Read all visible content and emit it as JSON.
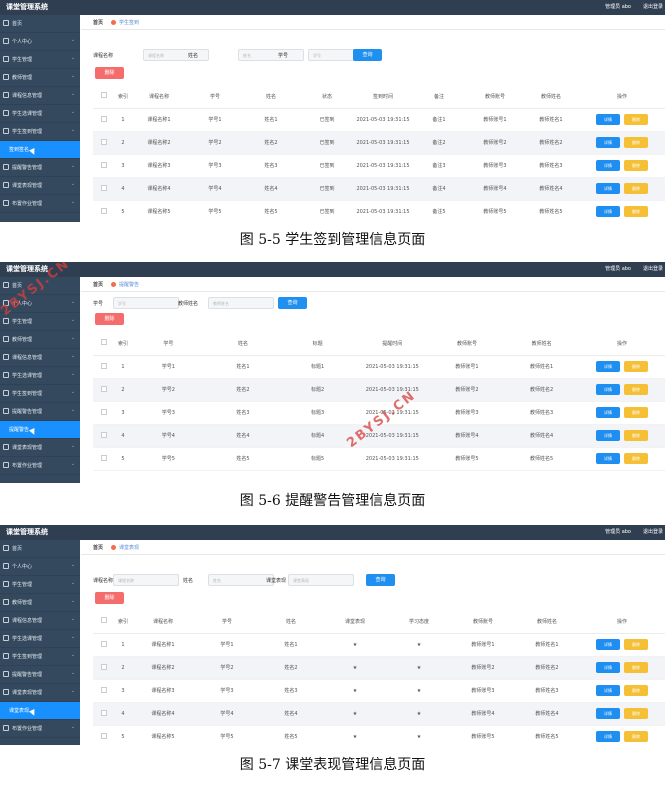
{
  "app_title": "课堂管理系统",
  "header": {
    "admin_label": "管理员 abo",
    "exit_label": "退出登录"
  },
  "sidebar": {
    "home": "首页",
    "items": [
      "个人中心",
      "学生管理",
      "教师管理",
      "课程信息管理",
      "学生选课管理",
      "学生签到管理",
      "提醒警告管理",
      "课堂表现管理",
      "布置作业管理"
    ]
  },
  "common": {
    "home_tab": "首页",
    "search_btn": "查询",
    "delete_btn": "删除",
    "detail_btn": "详情",
    "row_delete_btn": "删除",
    "ops_header": "操作",
    "index_header": "索引",
    "placeholder_course": "课程名称",
    "placeholder_account": "账号",
    "placeholder_teacher": "教师姓名"
  },
  "watermark": "2BYSJ.CN",
  "screens": [
    {
      "caption": "图 5-5 学生签到管理信息页面",
      "tab": "学生签到",
      "active_sidebar": 6,
      "sub_label": "签到签名",
      "filters": [
        {
          "label": "课程名称",
          "placeholder": "课程名称"
        },
        {
          "label": "姓名",
          "placeholder": "姓名"
        },
        {
          "label": "学号",
          "placeholder": "学号"
        }
      ],
      "columns": [
        "课程名称",
        "学号",
        "姓名",
        "状态",
        "签到时间",
        "备注",
        "教师账号",
        "教师姓名"
      ],
      "rows": [
        [
          "1",
          "课程名称1",
          "学号1",
          "姓名1",
          "已签到",
          "2021-05-03 19:31:15",
          "备注1",
          "教师账号1",
          "教师姓名1"
        ],
        [
          "2",
          "课程名称2",
          "学号2",
          "姓名2",
          "已签到",
          "2021-05-03 19:31:15",
          "备注2",
          "教师账号2",
          "教师姓名2"
        ],
        [
          "3",
          "课程名称3",
          "学号3",
          "姓名3",
          "已签到",
          "2021-05-03 19:31:15",
          "备注3",
          "教师账号3",
          "教师姓名3"
        ],
        [
          "4",
          "课程名称4",
          "学号4",
          "姓名4",
          "已签到",
          "2021-05-03 19:31:15",
          "备注4",
          "教师账号4",
          "教师姓名4"
        ],
        [
          "5",
          "课程名称5",
          "学号5",
          "姓名5",
          "已签到",
          "2021-05-03 19:31:15",
          "备注5",
          "教师账号5",
          "教师姓名5"
        ]
      ]
    },
    {
      "caption": "图 5-6 提醒警告管理信息页面",
      "tab": "提醒警告",
      "active_sidebar": 7,
      "sub_label": "提醒警告",
      "filters": [
        {
          "label": "学号",
          "placeholder": "学号"
        },
        {
          "label": "教师姓名",
          "placeholder": "教师姓名"
        }
      ],
      "columns": [
        "学号",
        "姓名",
        "标题",
        "提醒时间",
        "教师账号",
        "教师姓名"
      ],
      "rows": [
        [
          "1",
          "学号1",
          "姓名1",
          "标题1",
          "2021-05-03 19:31:15",
          "教师账号1",
          "教师姓名1"
        ],
        [
          "2",
          "学号2",
          "姓名2",
          "标题2",
          "2021-05-03 19:31:15",
          "教师账号2",
          "教师姓名2"
        ],
        [
          "3",
          "学号3",
          "姓名3",
          "标题3",
          "2021-05-03 19:31:15",
          "教师账号3",
          "教师姓名3"
        ],
        [
          "4",
          "学号4",
          "姓名4",
          "标题4",
          "2021-05-03 19:31:15",
          "教师账号4",
          "教师姓名4"
        ],
        [
          "5",
          "学号5",
          "姓名5",
          "标题5",
          "2021-05-03 19:31:15",
          "教师账号5",
          "教师姓名5"
        ]
      ]
    },
    {
      "caption": "图 5-7 课堂表现管理信息页面",
      "tab": "课堂表现",
      "active_sidebar": 8,
      "sub_label": "课堂表现",
      "filters": [
        {
          "label": "课程名称",
          "placeholder": "课程名称"
        },
        {
          "label": "姓名",
          "placeholder": "姓名"
        },
        {
          "label": "课堂表现",
          "placeholder": "课堂表现"
        }
      ],
      "columns": [
        "课程名称",
        "学号",
        "姓名",
        "课堂表现",
        "学习态度",
        "教师账号",
        "教师姓名"
      ],
      "rows": [
        [
          "1",
          "课程名称1",
          "学号1",
          "姓名1",
          "★",
          "★",
          "教师账号1",
          "教师姓名1"
        ],
        [
          "2",
          "课程名称2",
          "学号2",
          "姓名2",
          "★",
          "★",
          "教师账号2",
          "教师姓名2"
        ],
        [
          "3",
          "课程名称3",
          "学号3",
          "姓名3",
          "★",
          "★",
          "教师账号3",
          "教师姓名3"
        ],
        [
          "4",
          "课程名称4",
          "学号4",
          "姓名4",
          "★",
          "★",
          "教师账号4",
          "教师姓名4"
        ],
        [
          "5",
          "课程名称5",
          "学号5",
          "姓名5",
          "★",
          "★",
          "教师账号5",
          "教师姓名5"
        ]
      ]
    }
  ]
}
